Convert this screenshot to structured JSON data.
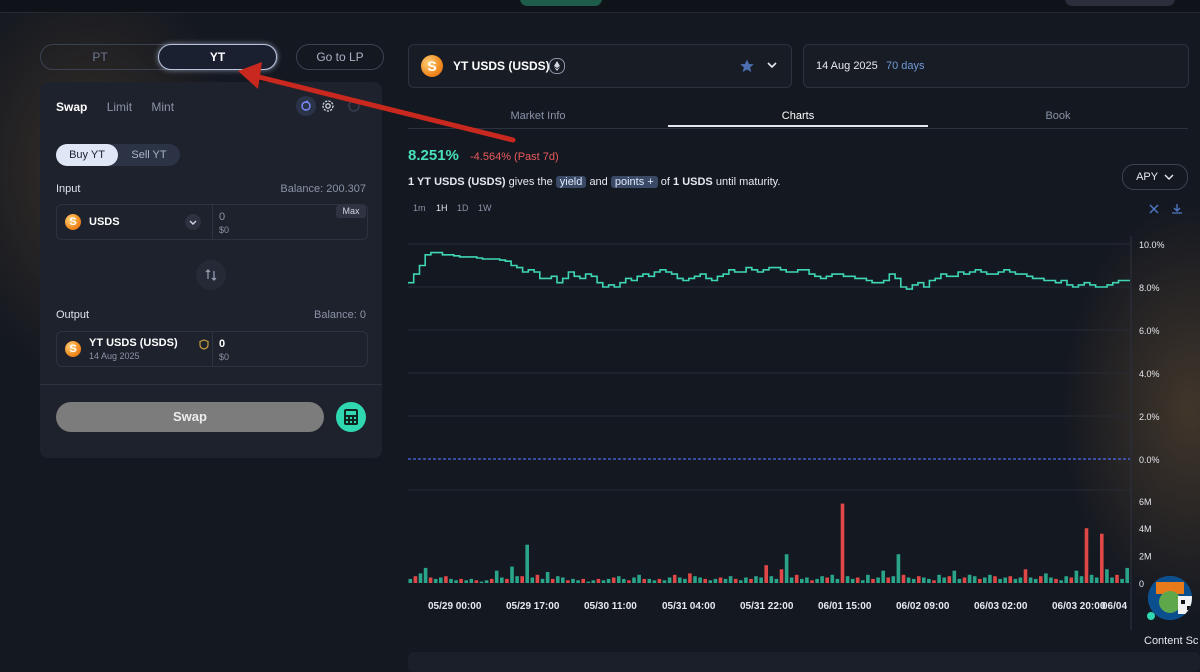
{
  "segment": {
    "pt": "PT",
    "yt": "YT",
    "go_lp": "Go to LP"
  },
  "swap_card": {
    "tabs": [
      "Swap",
      "Limit",
      "Mint"
    ],
    "buy": "Buy YT",
    "sell": "Sell YT",
    "input_label": "Input",
    "input_balance": "Balance: 200.307",
    "input_token": "USDS",
    "input_amount": "0",
    "input_usd": "$0",
    "max": "Max",
    "output_label": "Output",
    "output_balance": "Balance: 0",
    "output_token": "YT USDS (USDS)",
    "output_date": "14 Aug 2025",
    "output_amount": "0",
    "output_usd": "$0",
    "swap_button": "Swap"
  },
  "market": {
    "name": "YT USDS (USDS)",
    "expiry": "14 Aug 2025",
    "days": "70 days"
  },
  "right_tabs": [
    "Market Info",
    "Charts",
    "Book"
  ],
  "summary": {
    "value": "8.251%",
    "change": "-4.564% (Past 7d)",
    "desc_prefix": "1 YT USDS (USDS)",
    "desc_gives": "gives the",
    "yield": "yield",
    "and": "and",
    "points": "points +",
    "desc_of": "of",
    "desc_amount": "1 USDS",
    "desc_suffix": "until maturity.",
    "apy_select": "APY"
  },
  "timeframes": [
    "1m",
    "1H",
    "1D",
    "1W"
  ],
  "content_label": "Content Sc",
  "colors": {
    "accent": "#2fd8b0",
    "line": "#3ed6b4",
    "negative": "#e85b5b",
    "volume_up": "#2aa58a",
    "volume_down": "#e04848",
    "baseline": "#4f6bf0",
    "arrow": "#c8281e"
  },
  "chart_data": {
    "type": "line",
    "x_ticks": [
      "05/29 00:00",
      "05/29 17:00",
      "05/30 11:00",
      "05/31 04:00",
      "05/31 22:00",
      "06/01 15:00",
      "06/02 09:00",
      "06/03 02:00",
      "06/03 20:00",
      "06/04"
    ],
    "y_ticks": [
      "10.0%",
      "8.0%",
      "6.0%",
      "4.0%",
      "2.0%",
      "0.0%"
    ],
    "ylim": [
      0,
      10.5
    ],
    "baseline": 0,
    "apy": [
      8.2,
      8.6,
      9.0,
      9.5,
      9.6,
      9.6,
      9.5,
      9.5,
      9.45,
      9.4,
      9.4,
      9.4,
      9.35,
      9.3,
      9.3,
      9.3,
      9.25,
      9.2,
      9.0,
      8.9,
      8.7,
      8.8,
      8.7,
      8.4,
      8.4,
      8.5,
      8.2,
      8.4,
      8.7,
      8.5,
      8.4,
      8.6,
      8.5,
      8.2,
      8.0,
      8.1,
      8.0,
      8.2,
      8.4,
      8.3,
      8.5,
      8.6,
      8.5,
      8.7,
      8.8,
      8.7,
      8.6,
      8.4,
      8.3,
      8.4,
      8.5,
      8.6,
      8.4,
      8.3,
      8.5,
      8.6,
      8.8,
      8.7,
      8.7,
      8.9,
      8.8,
      8.7,
      8.8,
      8.9,
      8.9,
      8.8,
      8.7,
      8.7,
      8.8,
      8.8,
      8.6,
      8.5,
      8.4,
      8.5,
      8.6,
      8.6,
      8.5,
      8.5,
      8.4,
      8.4,
      8.3,
      8.2,
      8.2,
      8.3,
      8.6,
      8.4,
      8.0,
      7.9,
      8.1,
      8.2,
      8.0,
      8.3,
      8.4,
      8.6,
      8.5,
      8.5,
      8.7,
      8.6,
      8.7,
      8.8,
      8.7,
      8.6,
      8.6,
      8.7,
      8.8,
      8.7,
      8.6,
      8.6,
      8.5,
      8.4,
      8.4,
      8.3,
      8.3,
      8.2,
      8.3,
      8.1,
      8.0,
      8.1,
      8.2,
      8.1,
      8.0,
      8.0,
      8.1,
      8.2,
      8.3,
      8.3
    ],
    "volume_ticks": [
      "6M",
      "4M",
      "2M",
      "0"
    ],
    "volume_max": 6.5,
    "volume": [
      0.3,
      0.5,
      0.7,
      1.1,
      0.4,
      0.3,
      0.4,
      0.5,
      0.3,
      0.2,
      0.3,
      0.2,
      0.3,
      0.2,
      0.1,
      0.2,
      0.3,
      0.9,
      0.4,
      0.3,
      1.2,
      0.5,
      0.5,
      2.8,
      0.4,
      0.6,
      0.3,
      0.8,
      0.3,
      0.5,
      0.4,
      0.2,
      0.3,
      0.2,
      0.3,
      0.1,
      0.2,
      0.3,
      0.2,
      0.3,
      0.4,
      0.5,
      0.3,
      0.2,
      0.4,
      0.6,
      0.3,
      0.3,
      0.2,
      0.3,
      0.2,
      0.4,
      0.6,
      0.4,
      0.3,
      0.7,
      0.5,
      0.4,
      0.3,
      0.2,
      0.3,
      0.4,
      0.3,
      0.5,
      0.3,
      0.2,
      0.4,
      0.3,
      0.5,
      0.4,
      1.3,
      0.5,
      0.3,
      1.0,
      2.1,
      0.4,
      0.6,
      0.3,
      0.4,
      0.2,
      0.3,
      0.5,
      0.4,
      0.6,
      0.3,
      5.8,
      0.5,
      0.3,
      0.4,
      0.2,
      0.6,
      0.3,
      0.4,
      0.9,
      0.4,
      0.5,
      2.1,
      0.6,
      0.4,
      0.3,
      0.5,
      0.4,
      0.3,
      0.2,
      0.6,
      0.4,
      0.5,
      0.9,
      0.3,
      0.4,
      0.6,
      0.5,
      0.3,
      0.4,
      0.6,
      0.5,
      0.3,
      0.4,
      0.5,
      0.3,
      0.4,
      1.0,
      0.4,
      0.3,
      0.5,
      0.7,
      0.4,
      0.3,
      0.2,
      0.5,
      0.4,
      0.9,
      0.5,
      4.0,
      0.6,
      0.4,
      3.6,
      1.0,
      0.4,
      0.6,
      0.3,
      1.1
    ]
  }
}
